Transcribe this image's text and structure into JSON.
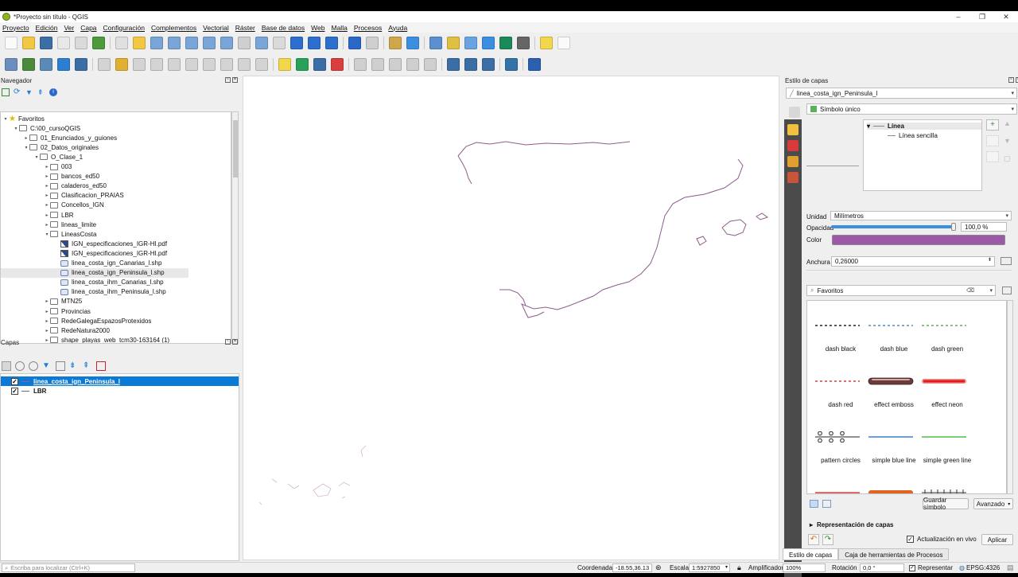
{
  "window": {
    "title": "*Proyecto sin título - QGIS"
  },
  "menu": [
    "Proyecto",
    "Edición",
    "Ver",
    "Capa",
    "Configuración",
    "Complementos",
    "Vectorial",
    "Ráster",
    "Base de datos",
    "Web",
    "Malla",
    "Procesos",
    "Ayuda"
  ],
  "navigator": {
    "title": "Navegador",
    "tree": [
      {
        "label": "Favoritos",
        "type": "star",
        "indent": 0,
        "arrow": "▾"
      },
      {
        "label": "C:\\00_cursoQGIS",
        "type": "folder",
        "indent": 1,
        "arrow": "▾"
      },
      {
        "label": "01_Enunciados_y_guiones",
        "type": "folder",
        "indent": 2,
        "arrow": "▸"
      },
      {
        "label": "02_Datos_originales",
        "type": "folder",
        "indent": 2,
        "arrow": "▾"
      },
      {
        "label": "O_Clase_1",
        "type": "folder",
        "indent": 3,
        "arrow": "▾"
      },
      {
        "label": "003",
        "type": "folder",
        "indent": 4,
        "arrow": "▸"
      },
      {
        "label": "bancos_ed50",
        "type": "folder",
        "indent": 4,
        "arrow": "▸"
      },
      {
        "label": "caladeros_ed50",
        "type": "folder",
        "indent": 4,
        "arrow": "▸"
      },
      {
        "label": "Clasificacion_PRAIAS",
        "type": "folder",
        "indent": 4,
        "arrow": "▸"
      },
      {
        "label": "Concellos_IGN",
        "type": "folder",
        "indent": 4,
        "arrow": "▸"
      },
      {
        "label": "LBR",
        "type": "folder",
        "indent": 4,
        "arrow": "▸"
      },
      {
        "label": "lineas_limite",
        "type": "folder",
        "indent": 4,
        "arrow": "▸"
      },
      {
        "label": "LineasCosta",
        "type": "folder",
        "indent": 4,
        "arrow": "▾"
      },
      {
        "label": "IGN_especificaciones_IGR-HI.pdf",
        "type": "pdf",
        "indent": 5,
        "arrow": ""
      },
      {
        "label": "IGN_especificaciones_IGR-HI.pdf",
        "type": "pdf",
        "indent": 5,
        "arrow": ""
      },
      {
        "label": "linea_costa_ign_Canarias_l.shp",
        "type": "file",
        "indent": 5,
        "arrow": ""
      },
      {
        "label": "linea_costa_ign_Peninsula_l.shp",
        "type": "file",
        "indent": 5,
        "arrow": "",
        "selected": true
      },
      {
        "label": "linea_costa_ihm_Canarias_l.shp",
        "type": "file",
        "indent": 5,
        "arrow": ""
      },
      {
        "label": "linea_costa_ihm_Peninsula_l.shp",
        "type": "file",
        "indent": 5,
        "arrow": ""
      },
      {
        "label": "MTN25",
        "type": "folder",
        "indent": 4,
        "arrow": "▸"
      },
      {
        "label": "Provincias",
        "type": "folder",
        "indent": 4,
        "arrow": "▸"
      },
      {
        "label": "RedeGalegaEspazosProtexidos",
        "type": "folder",
        "indent": 4,
        "arrow": "▸"
      },
      {
        "label": "RedeNatura2000",
        "type": "folder",
        "indent": 4,
        "arrow": "▸"
      },
      {
        "label": "shape_playas_web_tcm30-163164 (1)",
        "type": "folder",
        "indent": 4,
        "arrow": "▸"
      }
    ]
  },
  "layers_panel": {
    "title": "Capas",
    "items": [
      {
        "label": "linea_costa_ign_Peninsula_l",
        "checked": true,
        "selected": true,
        "color": "#a05a9a"
      },
      {
        "label": "LBR",
        "checked": true,
        "selected": false,
        "color": "#6b6b6b"
      }
    ]
  },
  "style_panel": {
    "title": "Estilo de capas",
    "layer_combo": "linea_costa_ign_Peninsula_l",
    "renderer_combo": "Símbolo único",
    "tree_root": "Línea",
    "tree_child": "Línea sencilla",
    "unit_label": "Unidad",
    "unit_value": "Milímetros",
    "opacity_label": "Opacidad",
    "opacity_value": "100,0 %",
    "opacity_fraction": 1.0,
    "color_label": "Color",
    "color_value": "#9b59a8",
    "width_label": "Anchura",
    "width_value": "0,26000",
    "search_value": "Favoritos",
    "gallery": [
      {
        "name": "dash  black",
        "kind": "dash",
        "color": "#222222"
      },
      {
        "name": "dash blue",
        "kind": "dash",
        "color": "#4a8fc7"
      },
      {
        "name": "dash green",
        "kind": "dash",
        "color": "#5ab25a"
      },
      {
        "name": "dash red",
        "kind": "dash",
        "color": "#d04040"
      },
      {
        "name": "effect emboss",
        "kind": "emboss",
        "color": "#6e3a3a"
      },
      {
        "name": "effect neon",
        "kind": "neon",
        "color": "#e21b1b"
      },
      {
        "name": "pattern circles",
        "kind": "circles",
        "color": "#222222"
      },
      {
        "name": "simple blue line",
        "kind": "solid",
        "color": "#3f7fc4"
      },
      {
        "name": "simple green line",
        "kind": "solid",
        "color": "#54b848"
      },
      {
        "name": "",
        "kind": "solid",
        "color": "#d03a3a"
      },
      {
        "name": "",
        "kind": "thick",
        "color": "#e0651f"
      },
      {
        "name": "",
        "kind": "ticks",
        "color": "#333333"
      }
    ],
    "save_button": "Guardar símbolo",
    "advanced_button": "Avanzado",
    "layer_rendering": "Representación de capas",
    "live_update": "Actualización en vivo",
    "apply_button": "Aplicar",
    "tabs": [
      "Estilo de capas",
      "Caja de herramientas de Procesos"
    ]
  },
  "statusbar": {
    "search_placeholder": "Escriba para localizar (Ctrl+K)",
    "coord_label": "Coordenada",
    "coord_value": "-18.55,36.13",
    "scale_label": "Escala",
    "scale_value": "1:5927850",
    "magnifier_label": "Amplificador",
    "magnifier_value": "100%",
    "rotation_label": "Rotación",
    "rotation_value": "0,0 °",
    "render_label": "Representar",
    "crs": "EPSG:4326"
  }
}
